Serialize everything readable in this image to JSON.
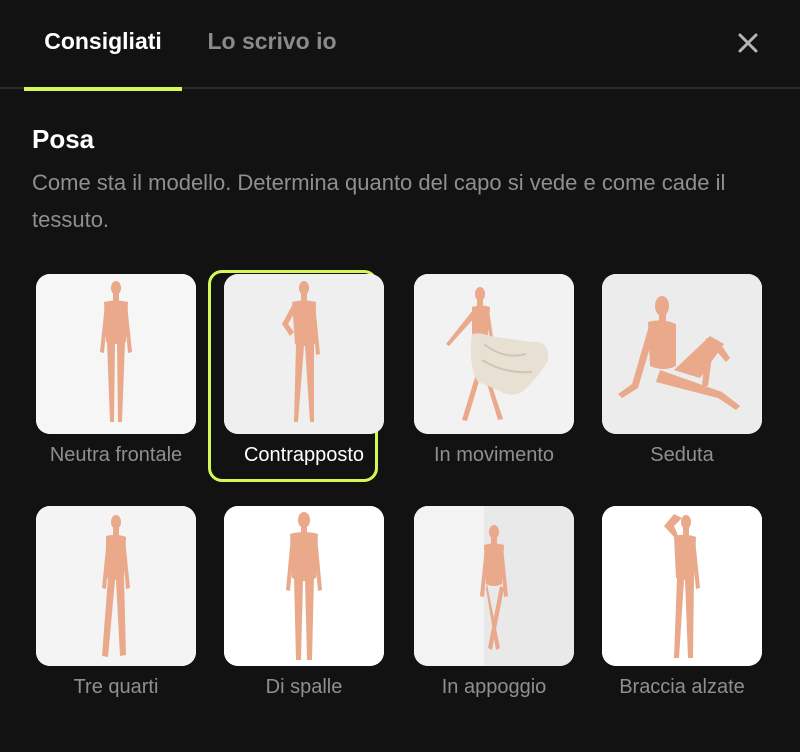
{
  "tabs": [
    {
      "label": "Consigliati",
      "active": true
    },
    {
      "label": "Lo scrivo io",
      "active": false
    }
  ],
  "close_icon": "close-icon",
  "section": {
    "title": "Posa",
    "description": "Come sta il modello. Determina quanto del capo si vede e come cade il tessuto."
  },
  "options": [
    {
      "label": "Neutra frontale",
      "selected": false
    },
    {
      "label": "Contrapposto",
      "selected": true
    },
    {
      "label": "In movimento",
      "selected": false
    },
    {
      "label": "Seduta",
      "selected": false
    },
    {
      "label": "Tre quarti",
      "selected": false
    },
    {
      "label": "Di spalle",
      "selected": false
    },
    {
      "label": "In appoggio",
      "selected": false
    },
    {
      "label": "Braccia alzate",
      "selected": false
    }
  ],
  "colors": {
    "background": "#121212",
    "accent": "#d4f75a",
    "text_primary": "#ffffff",
    "text_muted": "#8f8f8f",
    "skin": "#e9a98a"
  }
}
